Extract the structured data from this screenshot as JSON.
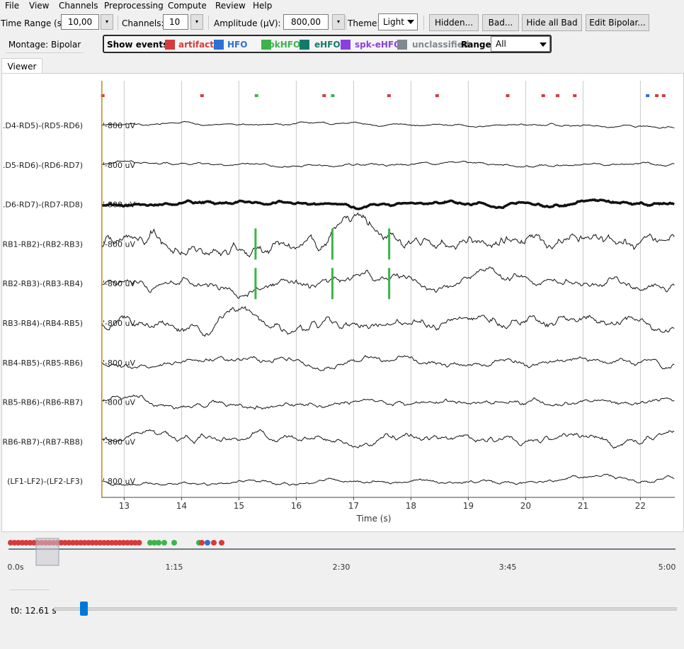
{
  "menu": [
    "File",
    "View",
    "Channels",
    "Preprocessing",
    "Compute",
    "Review",
    "Help"
  ],
  "toolbar": {
    "time_range_label": "Time Range (s):",
    "time_range_value": "10,00",
    "channels_label": "Channels:",
    "channels_value": "10",
    "amplitude_label": "Amplitude (µV): ±",
    "amplitude_value": "800,00",
    "theme_label": "Theme:",
    "theme_value": "Light",
    "hidden_btn": "Hidden...",
    "bad_btn": "Bad...",
    "hide_all_bad_btn": "Hide all Bad",
    "edit_bipolar_btn": "Edit Bipolar...",
    "spin_glyph": "▾"
  },
  "montage_label": "Montage: Bipolar",
  "events": {
    "title": "Show events:",
    "types": [
      {
        "label": "artifact",
        "color": "#d63b3b"
      },
      {
        "label": "HFO",
        "color": "#2f6fd6"
      },
      {
        "label": "spkHFO",
        "color": "#3cb44b"
      },
      {
        "label": "eHFO",
        "color": "#137a6b"
      },
      {
        "label": "spk-eHFO",
        "color": "#8a3fe0"
      },
      {
        "label": "unclassified",
        "color": "#808890"
      }
    ],
    "range_label": "Range",
    "range_value": "All"
  },
  "tab_label": "Viewer",
  "plot": {
    "channels": [
      ".D4-RD5)-(RD5-RD6)",
      ".D5-RD6)-(RD6-RD7)",
      ".D6-RD7)-(RD7-RD8)",
      "RB1-RB2)-(RB2-RB3)",
      "RB2-RB3)-(RB3-RB4)",
      "RB3-RB4)-(RB4-RB5)",
      "RB4-RB5)-(RB5-RB6)",
      "RB5-RB6)-(RB6-RB7)",
      "RB6-RB7)-(RB7-RB8)",
      "(LF1-LF2)-(LF2-LF3)"
    ],
    "amp_text": "800 uV",
    "x_ticks": [
      "13",
      "14",
      "15",
      "16",
      "17",
      "18",
      "19",
      "20",
      "21",
      "22"
    ],
    "x_label": "Time (s)",
    "x_start": 12.6,
    "x_end": 22.6,
    "cursor_time": 12.61,
    "event_markers": [
      {
        "t": 12.62,
        "c": "artifact"
      },
      {
        "t": 14.35,
        "c": "artifact"
      },
      {
        "t": 15.3,
        "c": "spkHFO"
      },
      {
        "t": 16.48,
        "c": "artifact"
      },
      {
        "t": 16.63,
        "c": "spkHFO"
      },
      {
        "t": 17.61,
        "c": "artifact"
      },
      {
        "t": 18.45,
        "c": "artifact"
      },
      {
        "t": 19.68,
        "c": "artifact"
      },
      {
        "t": 20.3,
        "c": "artifact"
      },
      {
        "t": 20.55,
        "c": "artifact"
      },
      {
        "t": 20.85,
        "c": "artifact"
      },
      {
        "t": 22.12,
        "c": "HFO"
      },
      {
        "t": 22.28,
        "c": "artifact"
      },
      {
        "t": 22.4,
        "c": "artifact"
      }
    ],
    "highlights": [
      {
        "ch": 3,
        "t": 15.29,
        "c": "spkHFO"
      },
      {
        "ch": 4,
        "t": 15.29,
        "c": "spkHFO"
      },
      {
        "ch": 3,
        "t": 16.63,
        "c": "spkHFO"
      },
      {
        "ch": 4,
        "t": 16.63,
        "c": "spkHFO"
      },
      {
        "ch": 3,
        "t": 17.62,
        "c": "spkHFO"
      },
      {
        "ch": 4,
        "t": 17.62,
        "c": "spkHFO"
      }
    ]
  },
  "overview": {
    "ticks": [
      "0.0s",
      "1:15",
      "2:30",
      "3:45",
      "5:00"
    ]
  },
  "t0_label": "t0: 12.61 s"
}
